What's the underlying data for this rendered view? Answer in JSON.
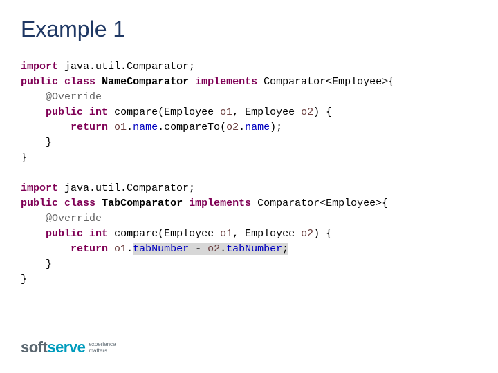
{
  "title": "Example 1",
  "code1": {
    "l1a": "import",
    "l1b": " java.util.Comparator;",
    "l2a": "public",
    "l2b": "class",
    "l2c": "NameComparator",
    "l2d": "implements",
    "l2e": " Comparator<Employee>{",
    "l3": "    @Override",
    "l4a": "public",
    "l4b": "int",
    "l4c": " compare(Employee ",
    "l4d": "o1",
    "l4e": ", Employee ",
    "l4f": "o2",
    "l4g": ") {",
    "l5a": "return",
    "l5b": "o1",
    "l5c": "name",
    "l5d": ".compareTo(",
    "l5e": "o2",
    "l5f": "name",
    "l5g": ");",
    "l6": "    }",
    "l7": "}"
  },
  "code2": {
    "l1a": "import",
    "l1b": " java.util.Comparator;",
    "l2a": "public",
    "l2b": "class",
    "l2c": "TabComparator",
    "l2d": "implements",
    "l2e": " Comparator<Employee>{",
    "l3": "    @Override",
    "l4a": "public",
    "l4b": "int",
    "l4c": " compare(Employee ",
    "l4d": "o1",
    "l4e": ", Employee ",
    "l4f": "o2",
    "l4g": ") {",
    "l5a": "return",
    "l5b": "o1",
    "l5c": "tabNumber",
    "l5d": " - ",
    "l5e": "o2",
    "l5f": "tabNumber",
    "l5g": ";",
    "l6": "    }",
    "l7": "}"
  },
  "logo": {
    "soft": "soft",
    "serve": "serve",
    "tag1": "experience",
    "tag2": "matters"
  }
}
